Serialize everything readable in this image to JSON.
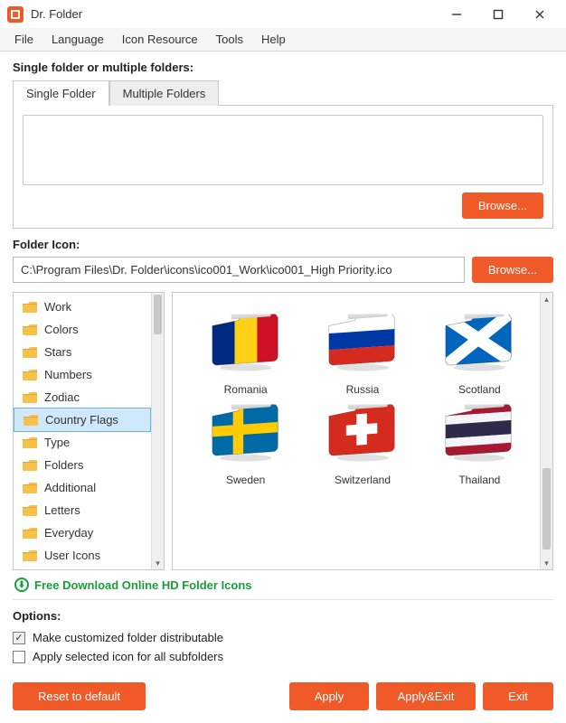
{
  "titlebar": {
    "title": "Dr. Folder"
  },
  "menu": {
    "items": [
      "File",
      "Language",
      "Icon Resource",
      "Tools",
      "Help"
    ]
  },
  "section1": {
    "label": "Single folder or multiple folders:",
    "tabs": {
      "single": "Single Folder",
      "multiple": "Multiple Folders",
      "active": 0
    },
    "browse": "Browse..."
  },
  "section2": {
    "label": "Folder Icon:",
    "path": "C:\\Program Files\\Dr. Folder\\icons\\ico001_Work\\ico001_High Priority.ico",
    "browse": "Browse..."
  },
  "categories": {
    "items": [
      "Work",
      "Colors",
      "Stars",
      "Numbers",
      "Zodiac",
      "Country Flags",
      "Type",
      "Folders",
      "Additional",
      "Letters",
      "Everyday",
      "User Icons"
    ],
    "selected_index": 5
  },
  "icons": {
    "items": [
      {
        "label": "Romania",
        "name": "romania",
        "svg": "romania"
      },
      {
        "label": "Russia",
        "name": "russia",
        "svg": "russia"
      },
      {
        "label": "Scotland",
        "name": "scotland",
        "svg": "scotland"
      },
      {
        "label": "Sweden",
        "name": "sweden",
        "svg": "sweden"
      },
      {
        "label": "Switzerland",
        "name": "switzerland",
        "svg": "switzerland"
      },
      {
        "label": "Thailand",
        "name": "thailand",
        "svg": "thailand"
      }
    ]
  },
  "download_link": "Free Download Online HD Folder Icons",
  "options": {
    "label": "Options:",
    "opt1": {
      "label": "Make customized folder distributable",
      "checked": true
    },
    "opt2": {
      "label": "Apply selected icon for all subfolders",
      "checked": false
    }
  },
  "footer": {
    "reset": "Reset to default",
    "apply": "Apply",
    "apply_exit": "Apply&Exit",
    "exit": "Exit"
  },
  "colors": {
    "accent": "#f05a28"
  }
}
